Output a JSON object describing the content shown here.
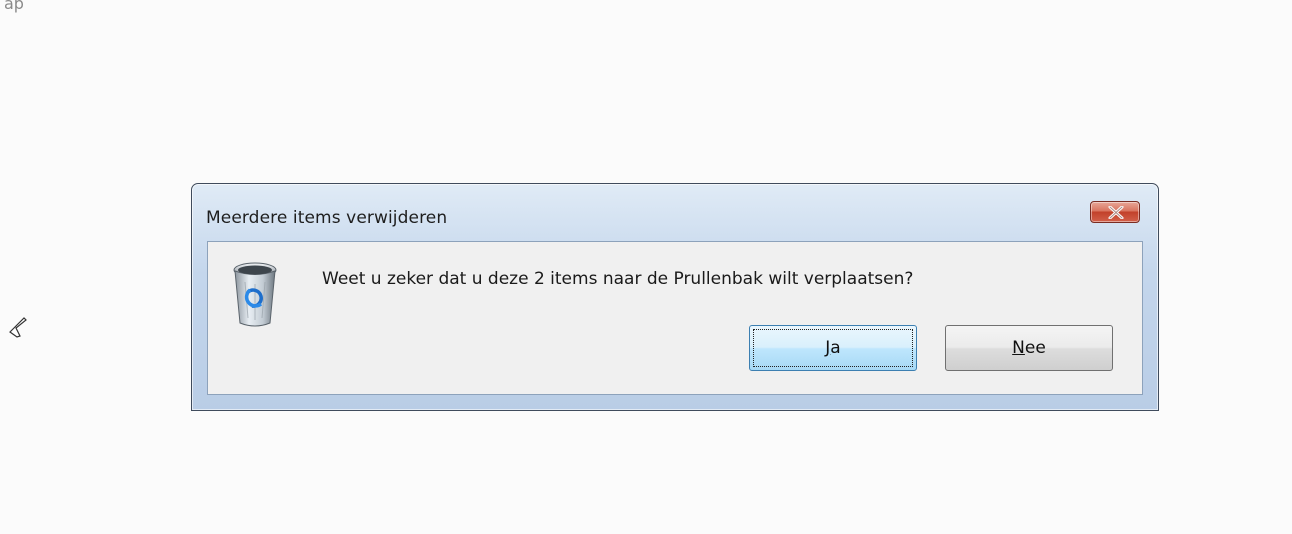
{
  "background_fragment": "ap",
  "dialog": {
    "title": "Meerdere items verwijderen",
    "message": "Weet u zeker dat u deze 2 items naar de Prullenbak wilt verplaatsen?",
    "buttons": {
      "yes": {
        "mnemonic": "J",
        "rest": "a"
      },
      "no": {
        "mnemonic": "N",
        "rest": "ee"
      }
    },
    "icon": "recycle-bin-icon",
    "close_icon": "close-icon"
  },
  "colors": {
    "titlebar": "#c4d6ec",
    "close_button": "#c2412a",
    "default_button_border": "#3c7fb1",
    "client": "#f0f0f0"
  }
}
